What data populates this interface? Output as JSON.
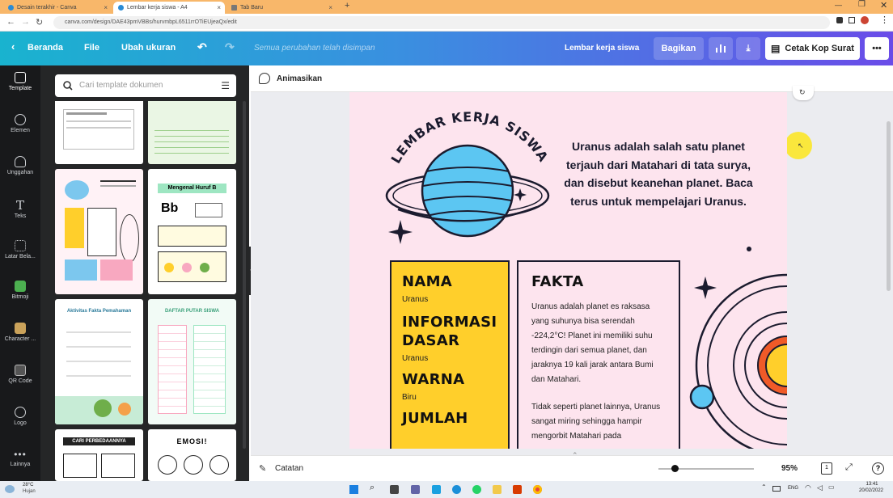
{
  "browser": {
    "tabs": [
      {
        "title": "Desain terakhir - Canva"
      },
      {
        "title": "Lembar kerja siswa - A4"
      },
      {
        "title": "Tab Baru"
      }
    ],
    "url": "canva.com/design/DAE43pmVBBs/hurvmbpL6511rrOTiEUjeaQx/edit",
    "back_icon": "back-arrow-icon",
    "forward_icon": "forward-arrow-icon",
    "reload_icon": "reload-icon"
  },
  "topbar": {
    "home": "Beranda",
    "file": "File",
    "resize": "Ubah ukuran",
    "status": "Semua perubahan telah disimpan",
    "doc_title": "Lembar kerja siswa",
    "share": "Bagikan",
    "print": "Cetak Kop Surat"
  },
  "rail": {
    "items": [
      {
        "label": "Template"
      },
      {
        "label": "Elemen"
      },
      {
        "label": "Unggahan"
      },
      {
        "label": "Teks"
      },
      {
        "label": "Latar Bela..."
      },
      {
        "label": "Bitmoji"
      },
      {
        "label": "Character ..."
      },
      {
        "label": "QR Code"
      },
      {
        "label": "Logo"
      },
      {
        "label": "Lainnya"
      }
    ]
  },
  "panel": {
    "search_placeholder": "Cari template dokumen",
    "thumbs": {
      "huruf_title": "Mengenal Huruf B",
      "huruf_bb": "Bb",
      "aktivitas_title": "Aktivitas Fakta Pemahaman",
      "daftar_title": "DAFTAR PUTAR SISWA",
      "perbedaan_title": "CARI PERBEDAANNYA",
      "emosi_title": "EMOSI!"
    }
  },
  "subbar": {
    "animate": "Animasikan"
  },
  "page": {
    "arc_title": "LEMBAR KERJA SISWA",
    "intro": "Uranus adalah salah satu planet terjauh dari Matahari di tata surya, dan disebut keanehan planet. Baca terus untuk mempelajari Uranus.",
    "card_left": {
      "nama_h": "NAMA",
      "nama_v": "Uranus",
      "info_h1": "INFORMASI",
      "info_h2": "DASAR",
      "info_v": "Uranus",
      "warna_h": "WARNA",
      "warna_v": "Biru",
      "jumlah_h": "JUMLAH"
    },
    "card_right": {
      "title": "FAKTA",
      "p1": "Uranus adalah planet es raksasa yang suhunya bisa serendah -224,2°C! Planet ini memiliki suhu terdingin dari semua planet, dan jaraknya 19 kali jarak antara Bumi dan Matahari.",
      "p2": "Tidak seperti planet lainnya, Uranus sangat miring sehingga hampir mengorbit Matahari pada"
    }
  },
  "bottombar": {
    "notes": "Catatan",
    "zoom": "95%",
    "page_num": "1",
    "help": "?",
    "zoom_fraction": 0.17
  },
  "taskbar": {
    "weather_temp": "28°C",
    "weather_desc": "Hujan",
    "lang": "ENG",
    "time": "13:41",
    "date": "20/02/2022"
  },
  "colors": {
    "accent_yellow": "#ffcf2b",
    "planet_blue": "#5cc6f2",
    "page_pink": "#fde4ee"
  }
}
